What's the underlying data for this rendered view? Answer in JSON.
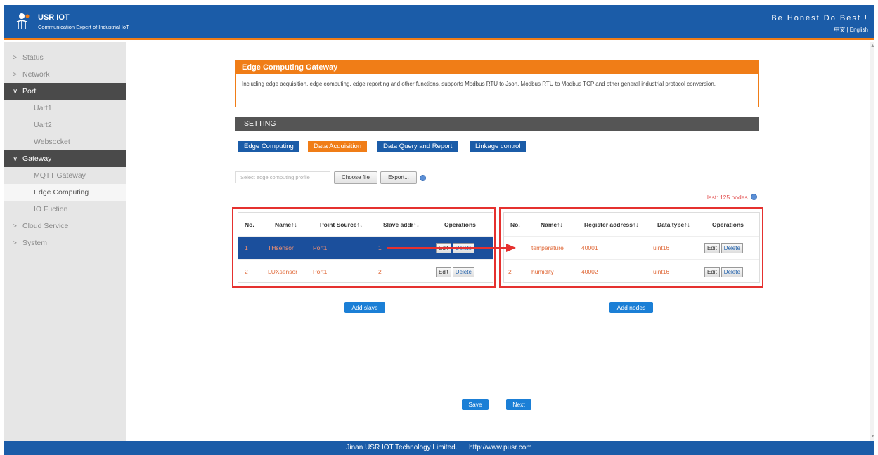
{
  "header": {
    "brand": "USR IOT",
    "tagline": "Communication Expert of Industrial IoT",
    "motto": "Be Honest Do Best !",
    "language": "中文 | English"
  },
  "sidebar": {
    "items": [
      {
        "label": "Status",
        "chevron": ">"
      },
      {
        "label": "Network",
        "chevron": ">"
      },
      {
        "label": "Port",
        "chevron": "∨"
      },
      {
        "label": "Uart1"
      },
      {
        "label": "Uart2"
      },
      {
        "label": "Websocket"
      },
      {
        "label": "Gateway",
        "chevron": "∨"
      },
      {
        "label": "MQTT Gateway"
      },
      {
        "label": "Edge Computing"
      },
      {
        "label": "IO Fuction"
      },
      {
        "label": "Cloud Service",
        "chevron": ">"
      },
      {
        "label": "System",
        "chevron": ">"
      }
    ]
  },
  "intro": {
    "title": "Edge Computing Gateway",
    "text": "Including edge acquisition, edge computing, edge reporting and other functions, supports Modbus RTU to Json, Modbus RTU to Modbus TCP and other general industrial protocol conversion."
  },
  "setting": {
    "label": "SETTING"
  },
  "tabs": [
    "Edge Computing",
    "Data Acquisition",
    "Data Query and Report",
    "Linkage control"
  ],
  "profile": {
    "placeholder": "Select edge computing profile",
    "choose_label": "Choose file",
    "export_label": "Export..."
  },
  "last_nodes": "last: 125 nodes",
  "slave_table": {
    "headers": [
      "No.",
      "Name↑↓",
      "Point Source↑↓",
      "Slave addr↑↓",
      "Operations"
    ],
    "rows": [
      {
        "no": "1",
        "name": "THsensor",
        "source": "Port1",
        "addr": "1"
      },
      {
        "no": "2",
        "name": "LUXsensor",
        "source": "Port1",
        "addr": "2"
      }
    ],
    "edit_label": "Edit",
    "delete_label": "Delete",
    "add_label": "Add slave"
  },
  "node_table": {
    "headers": [
      "No.",
      "Name↑↓",
      "Register address↑↓",
      "Data type↑↓",
      "Operations"
    ],
    "rows": [
      {
        "no": "1",
        "name": "temperature",
        "reg": "40001",
        "type": "uint16"
      },
      {
        "no": "2",
        "name": "humidity",
        "reg": "40002",
        "type": "uint16"
      }
    ],
    "edit_label": "Edit",
    "delete_label": "Delete",
    "add_label": "Add nodes"
  },
  "actions": {
    "save_label": "Save",
    "next_label": "Next"
  },
  "footer": {
    "company": "Jinan USR IOT Technology Limited.",
    "url": "http://www.pusr.com"
  },
  "colors": {
    "brand_blue": "#1b5ca8",
    "accent_orange": "#f07d17",
    "highlight_red": "#e5312f"
  }
}
